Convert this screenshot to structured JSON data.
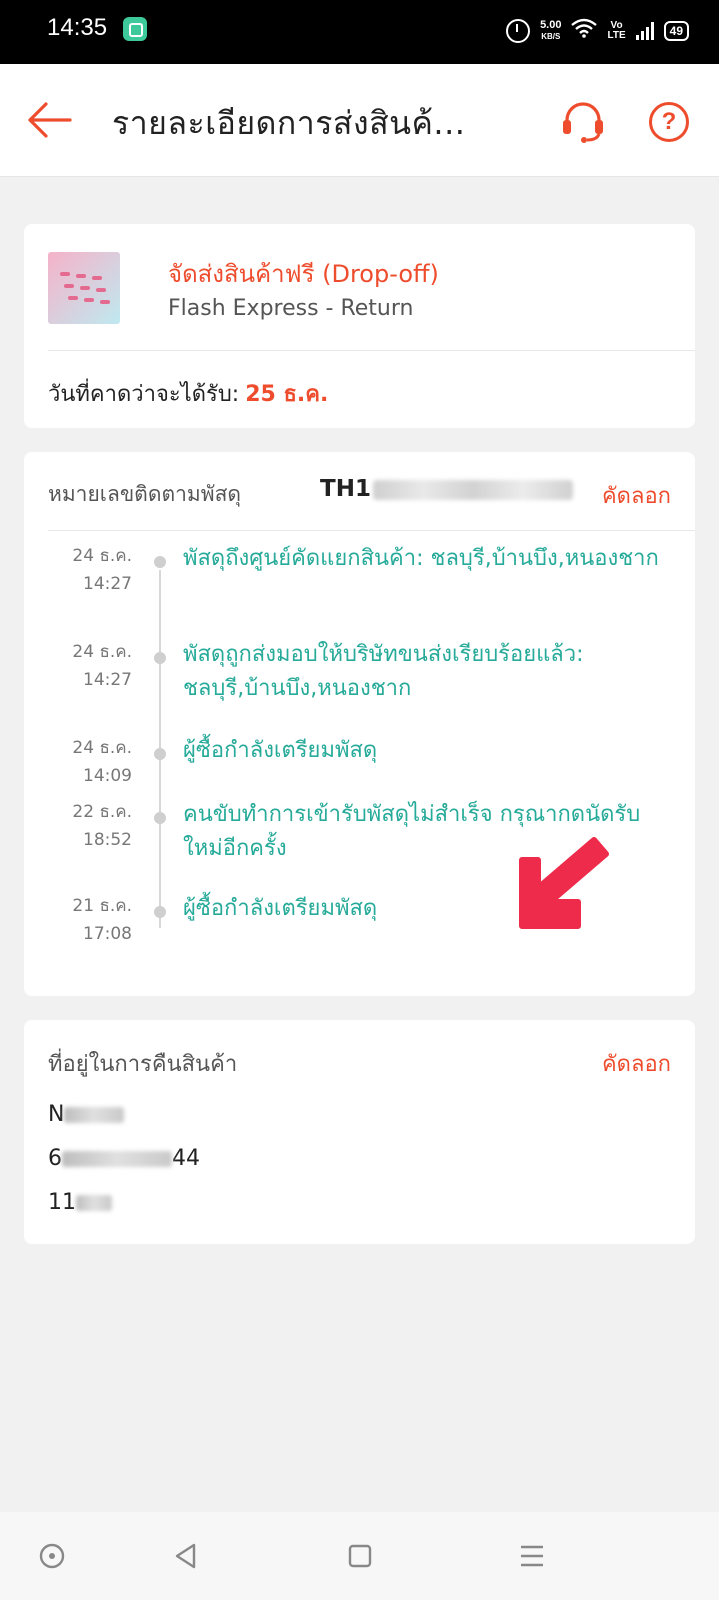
{
  "status_bar": {
    "time": "14:35",
    "speed_value": "5.00",
    "speed_unit": "KB/S",
    "volte_top": "Vo",
    "volte_bottom": "LTE",
    "battery": "49"
  },
  "header": {
    "title": "รายละเอียดการส่งสินค้...",
    "icons": [
      "back-arrow-icon",
      "headset-icon",
      "question-icon"
    ],
    "help_symbol": "?",
    "accent_color": "#ee4d2d"
  },
  "shipment": {
    "name": "จัดส่งสินค้าฟรี (Drop-off)",
    "courier": "Flash Express - Return",
    "eta_label": "วันที่คาดว่าจะได้รับ:",
    "eta_date": "25 ธ.ค."
  },
  "tracking": {
    "label": "หมายเลขติดตามพัสดุ",
    "number_prefix": "TH1",
    "copy_label": "คัดลอก",
    "event_color": "#26aa99",
    "events": [
      {
        "date": "24 ธ.ค.",
        "time": "14:27",
        "text": "พัสดุถึงศูนย์คัดแยกสินค้า: ชลบุรี,บ้านบึง,หนองชาก"
      },
      {
        "date": "24 ธ.ค.",
        "time": "14:27",
        "text": "พัสดุถูกส่งมอบให้บริษัทขนส่งเรียบร้อยแล้ว: ชลบุรี,บ้านบึง,หนองชาก"
      },
      {
        "date": "24 ธ.ค.",
        "time": "14:09",
        "text": "ผู้ซื้อกำลังเตรียมพัสดุ"
      },
      {
        "date": "22 ธ.ค.",
        "time": "18:52",
        "text": "คนขับทำการเข้ารับพัสดุไม่สำเร็จ กรุณากดนัดรับใหม่อีกครั้ง"
      },
      {
        "date": "21 ธ.ค.",
        "time": "17:08",
        "text": "ผู้ซื้อกำลังเตรียมพัสดุ"
      }
    ]
  },
  "return_address": {
    "label": "ที่อยู่ในการคืนสินค้า",
    "copy_label": "คัดลอก",
    "line1_visible": "N",
    "line2_prefix": "6",
    "line2_suffix": "44",
    "line3_visible": "11"
  },
  "nav_bar": {
    "icons": [
      "home-dot-icon",
      "back-triangle-icon",
      "recent-square-icon",
      "menu-lines-icon"
    ]
  }
}
